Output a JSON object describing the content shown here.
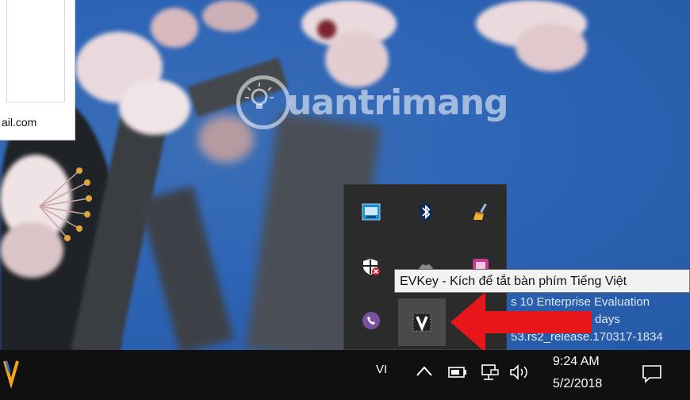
{
  "background_window": {
    "partial_text": "ail.com"
  },
  "watermark": {
    "brand": "uantrimang",
    "icon": "lightbulb-q-logo"
  },
  "tray_flyout": {
    "icons": [
      {
        "name": "intel-graphics-icon"
      },
      {
        "name": "bluetooth-icon"
      },
      {
        "name": "ccleaner-broom-icon"
      },
      {
        "name": "windows-defender-shield-icon"
      },
      {
        "name": "onedrive-cloud-icon"
      },
      {
        "name": "app-tile-icon"
      },
      {
        "name": "viber-icon"
      },
      {
        "name": "evkey-v-icon"
      }
    ]
  },
  "tooltip": {
    "text": "EVKey - Kích để tắt bàn phím Tiếng Việt"
  },
  "desktop_watermark_lines": [
    "s 10 Enterprise Evaluation",
    "alid for 46 days",
    "53.rs2_release.170317-1834"
  ],
  "taskbar": {
    "input_language": "VI",
    "clock_time": "9:24 AM",
    "clock_date": "5/2/2018",
    "colors": {
      "taskbar_bg": "#101010",
      "arrow": "#e8151b"
    }
  }
}
